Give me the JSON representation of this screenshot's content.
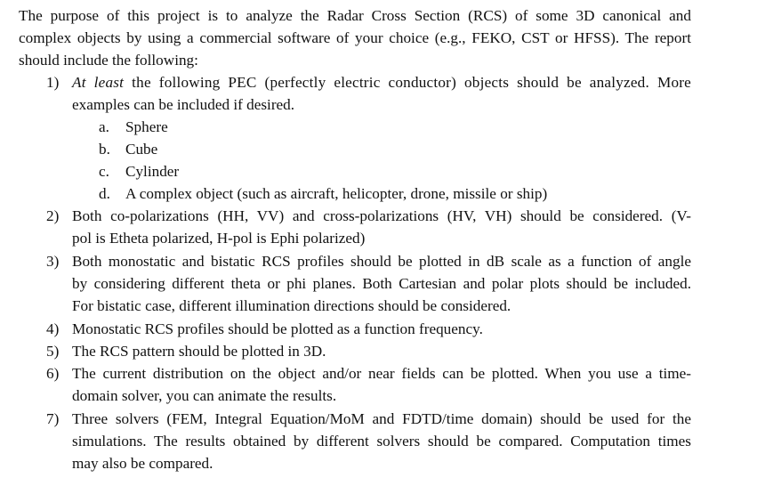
{
  "document": {
    "intro_lines": [
      "The purpose of this project is to analyze the Radar Cross Section (RCS) of some 3D canonical and",
      "complex objects by using a commercial software of your choice (e.g., FEKO, CST or HFSS). The report",
      "should include the following:"
    ],
    "items": [
      {
        "number": "1)",
        "lead_italic": "At least",
        "lines": [
          " the following PEC (perfectly electric conductor) objects should be analyzed. More",
          "examples can be included if desired."
        ],
        "subitems": [
          {
            "letter": "a.",
            "text": "Sphere"
          },
          {
            "letter": "b.",
            "text": "Cube"
          },
          {
            "letter": "c.",
            "text": "Cylinder"
          },
          {
            "letter": "d.",
            "text": "A complex object (such as aircraft, helicopter, drone, missile or ship)"
          }
        ]
      },
      {
        "number": "2)",
        "lines": [
          "Both co-polarizations (HH, VV) and cross-polarizations (HV, VH) should be considered. (V-",
          "pol is Etheta polarized, H-pol is Ephi polarized)"
        ]
      },
      {
        "number": "3)",
        "lines": [
          "Both monostatic and bistatic RCS profiles should be plotted in dB scale as a function of angle",
          "by considering different theta or phi planes. Both Cartesian and polar plots should be included.",
          "For bistatic case, different illumination directions should be considered."
        ]
      },
      {
        "number": "4)",
        "lines": [
          "Monostatic RCS profiles should be plotted as a function frequency."
        ]
      },
      {
        "number": "5)",
        "lines": [
          "The RCS pattern should be plotted in 3D."
        ]
      },
      {
        "number": "6)",
        "lines": [
          "The current distribution on the object and/or near fields can be plotted. When you use a time-",
          "domain solver, you can animate the results."
        ]
      },
      {
        "number": "7)",
        "lines": [
          "Three solvers (FEM, Integral Equation/MoM and FDTD/time domain) should be used for the",
          "simulations. The results obtained by different solvers should be compared. Computation times",
          "may also be compared."
        ]
      }
    ]
  }
}
